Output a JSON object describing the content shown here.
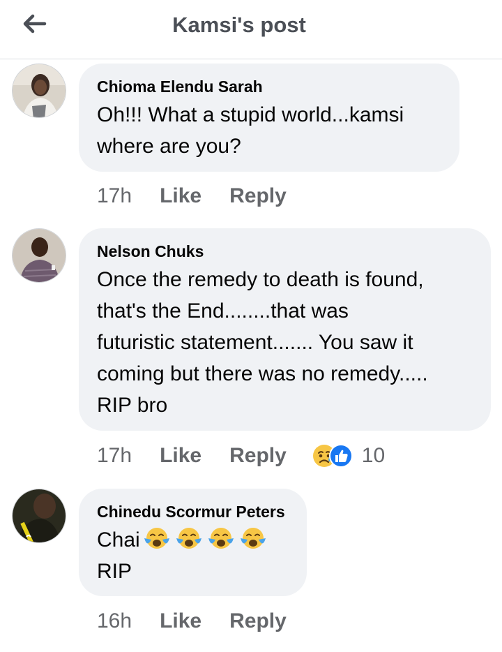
{
  "header": {
    "title": "Kamsi's post",
    "back_icon": "back-arrow-icon"
  },
  "comments": [
    {
      "author": "Chioma Elendu Sarah",
      "text": "Oh!!! What a stupid world...kamsi\nwhere are you?",
      "time": "17h",
      "like": "Like",
      "reply": "Reply"
    },
    {
      "author": "Nelson Chuks",
      "text": "Once the remedy to death is found,\nthat's the End........that was\nfuturistic statement....... You saw it\ncoming but there was no remedy.....\nRIP bro",
      "time": "17h",
      "like": "Like",
      "reply": "Reply",
      "reaction_count": "10",
      "reaction_icons": [
        "sad-reaction-icon",
        "like-reaction-icon"
      ]
    },
    {
      "author": "Chinedu Scormur Peters",
      "text_prefix": "Chai",
      "emoji_icons": [
        "loudly-crying-face-icon",
        "loudly-crying-face-icon",
        "loudly-crying-face-icon",
        "loudly-crying-face-icon"
      ],
      "text_line2": "RIP",
      "time": "16h",
      "like": "Like",
      "reply": "Reply"
    }
  ],
  "colors": {
    "bubble": "#f0f2f5",
    "meta": "#65676b",
    "like_blue": "#1877f2",
    "sad_yellow": "#f7c645"
  }
}
